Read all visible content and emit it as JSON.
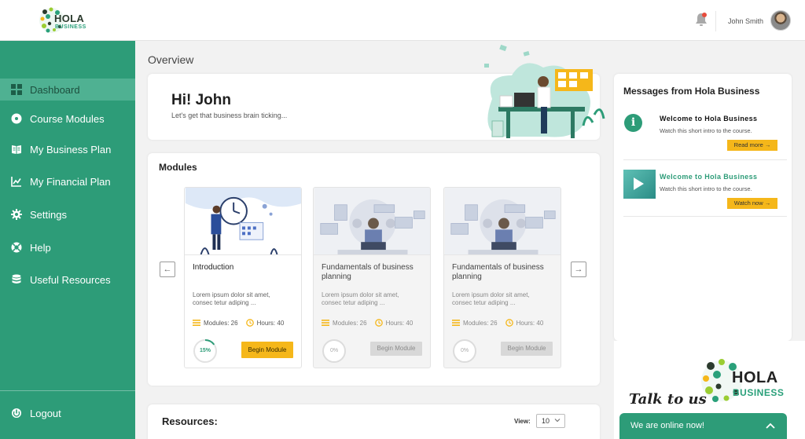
{
  "header": {
    "logo_word1": "HOLA",
    "logo_word2": "BUSINESS",
    "user_name": "John Smith"
  },
  "sidebar": {
    "items": [
      {
        "label": "Dashboard",
        "icon": "dashboard-icon",
        "active": true
      },
      {
        "label": "Course Modules",
        "icon": "disc-icon"
      },
      {
        "label": "My Business Plan",
        "icon": "book-icon"
      },
      {
        "label": "My Financial Plan",
        "icon": "chart-line-icon"
      },
      {
        "label": "Settings",
        "icon": "gear-icon"
      },
      {
        "label": "Help",
        "icon": "lifebuoy-icon"
      },
      {
        "label": "Useful Resources",
        "icon": "database-icon"
      }
    ],
    "logout_label": "Logout"
  },
  "overview": {
    "title": "Overview",
    "greeting": "Hi! John",
    "subtitle": "Let's get that business brain ticking..."
  },
  "modules": {
    "title": "Modules",
    "cards": [
      {
        "title": "Introduction",
        "desc": "Lorem ipsum dolor sit amet, consec tetur adiping ...",
        "modules": "Modules: 26",
        "hours": "Hours: 40",
        "progress_label": "15%",
        "progress": 0.15,
        "button": "Begin Module",
        "enabled": true
      },
      {
        "title": "Fundamentals of business planning",
        "desc": "Lorem ipsum dolor sit amet, consec tetur adiping ...",
        "modules": "Modules: 26",
        "hours": "Hours: 40",
        "progress_label": "0%",
        "progress": 0,
        "button": "Begin Module",
        "enabled": false
      },
      {
        "title": "Fundamentals of business planning",
        "desc": "Lorem ipsum dolor sit amet, consec tetur adiping ...",
        "modules": "Modules: 26",
        "hours": "Hours: 40",
        "progress_label": "0%",
        "progress": 0,
        "button": "Begin Module",
        "enabled": false
      }
    ]
  },
  "resources": {
    "title": "Resources:",
    "view_label": "View:",
    "view_value": "10"
  },
  "messages": {
    "title": "Messages from Hola Business",
    "items": [
      {
        "title": "Welcome to Hola Business",
        "subtitle": "Watch this short intro to the course.",
        "button": "Read more →",
        "type": "info"
      },
      {
        "title": "Welcome to Hola Business",
        "subtitle": "Watch this short intro to the course.",
        "button": "Watch now →",
        "type": "video"
      }
    ]
  },
  "chat": {
    "talk_label": "Talk to us",
    "logo_word1": "HOLA",
    "logo_word2": "BUSINESS",
    "online_label": "We are online now!"
  },
  "colors": {
    "brand_green": "#2d9c78",
    "accent_yellow": "#f5b71a"
  }
}
